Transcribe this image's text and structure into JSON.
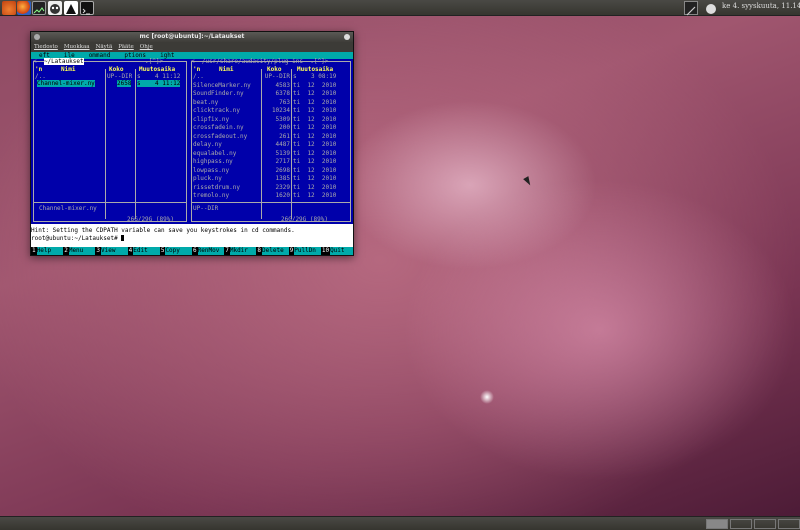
{
  "top_panel": {
    "clock": "ke 4. syyskuuta, 11.14"
  },
  "window": {
    "title": "mc [root@ubuntu]:~/Lataukset",
    "menu": [
      "Tiedosto",
      "Muokkaa",
      "Näytä",
      "Pääte",
      "Ohje"
    ]
  },
  "mc": {
    "menu": [
      "eft",
      "ile",
      "ommand",
      "ptions",
      "ight"
    ],
    "left_panel": {
      "path": "~/Lataukset",
      "path_suffix": ".[^]>",
      "headers": {
        "name_flag": "'n",
        "name": "Nimi",
        "size": "Koko",
        "mtime": "Muutosaika"
      },
      "rows": [
        {
          "name": "/..",
          "size": "UP--DIR",
          "mtime": "s    4 11:12",
          "selected": false
        },
        {
          "name": "Channel-mixer.ny",
          "size": "2658",
          "mtime": "s    4 11:12",
          "selected": true
        }
      ],
      "mini_status": "Channel-mixer.ny",
      "disk": "26G/29G (89%)"
    },
    "right_panel": {
      "path": "/usr/share/audacity/plug-ins",
      "path_suffix": ".[^]>",
      "headers": {
        "name_flag": "'n",
        "name": "Nimi",
        "size": "Koko",
        "mtime": "Muutosaika"
      },
      "rows": [
        {
          "name": "/..",
          "size": "UP--DIR",
          "mtime": "s    3 08:19"
        },
        {
          "name": "SilenceMarker.ny",
          "size": "4583",
          "mtime": "ti  12  2010"
        },
        {
          "name": "SoundFinder.ny",
          "size": "6378",
          "mtime": "ti  12  2010"
        },
        {
          "name": "beat.ny",
          "size": "763",
          "mtime": "ti  12  2010"
        },
        {
          "name": "clicktrack.ny",
          "size": "10234",
          "mtime": "ti  12  2010"
        },
        {
          "name": "clipfix.ny",
          "size": "5309",
          "mtime": "ti  12  2010"
        },
        {
          "name": "crossfadein.ny",
          "size": "200",
          "mtime": "ti  12  2010"
        },
        {
          "name": "crossfadeout.ny",
          "size": "261",
          "mtime": "ti  12  2010"
        },
        {
          "name": "delay.ny",
          "size": "4487",
          "mtime": "ti  12  2010"
        },
        {
          "name": "equalabel.ny",
          "size": "5139",
          "mtime": "ti  12  2010"
        },
        {
          "name": "highpass.ny",
          "size": "2717",
          "mtime": "ti  12  2010"
        },
        {
          "name": "lowpass.ny",
          "size": "2698",
          "mtime": "ti  12  2010"
        },
        {
          "name": "pluck.ny",
          "size": "1385",
          "mtime": "ti  12  2010"
        },
        {
          "name": "rissetdrum.ny",
          "size": "2329",
          "mtime": "ti  12  2010"
        },
        {
          "name": "tremolo.ny",
          "size": "1620",
          "mtime": "ti  12  2010"
        }
      ],
      "mini_status": "UP--DIR",
      "disk": "26G/29G (89%)"
    },
    "hint": "Hint: Setting the CDPATH variable can save you keystrokes in cd commands.",
    "prompt": "root@ubuntu:~/Lataukset# ",
    "fkeys": [
      {
        "n": "1",
        "label": "Help"
      },
      {
        "n": "2",
        "label": "Menu"
      },
      {
        "n": "3",
        "label": "View"
      },
      {
        "n": "4",
        "label": "Edit"
      },
      {
        "n": "5",
        "label": "Copy"
      },
      {
        "n": "6",
        "label": "RenMov"
      },
      {
        "n": "7",
        "label": "Mkdir"
      },
      {
        "n": "8",
        "label": "Delete"
      },
      {
        "n": "9",
        "label": "PullDn"
      },
      {
        "n": "10",
        "label": "Quit"
      }
    ]
  }
}
